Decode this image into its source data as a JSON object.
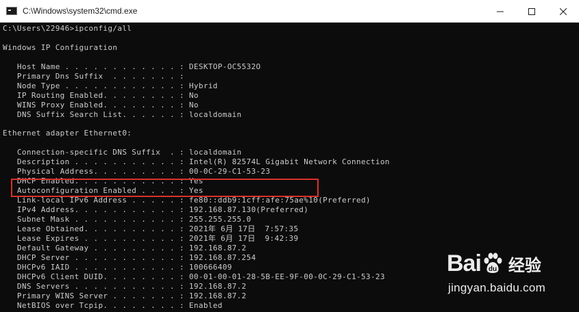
{
  "window": {
    "title": "C:\\Windows\\system32\\cmd.exe",
    "minimize_icon": "minimize-icon",
    "maximize_icon": "maximize-icon",
    "close_icon": "close-icon"
  },
  "console": {
    "lines": [
      "C:\\Users\\22946>ipconfig/all",
      "",
      "Windows IP Configuration",
      "",
      "   Host Name . . . . . . . . . . . . : DESKTOP-OC5532O",
      "   Primary Dns Suffix  . . . . . . . :",
      "   Node Type . . . . . . . . . . . . : Hybrid",
      "   IP Routing Enabled. . . . . . . . : No",
      "   WINS Proxy Enabled. . . . . . . . : No",
      "   DNS Suffix Search List. . . . . . : localdomain",
      "",
      "Ethernet adapter Ethernet0:",
      "",
      "   Connection-specific DNS Suffix  . : localdomain",
      "   Description . . . . . . . . . . . : Intel(R) 82574L Gigabit Network Connection",
      "   Physical Address. . . . . . . . . : 00-0C-29-C1-53-23",
      "   DHCP Enabled. . . . . . . . . . . : Yes",
      "   Autoconfiguration Enabled . . . . : Yes",
      "   Link-local IPv6 Address . . . . . : fe80::ddb9:1cff:afe:75ae%10(Preferred)",
      "   IPv4 Address. . . . . . . . . . . : 192.168.87.130(Preferred)",
      "   Subnet Mask . . . . . . . . . . . : 255.255.255.0",
      "   Lease Obtained. . . . . . . . . . : 2021年 6月 17日  7:57:35",
      "   Lease Expires . . . . . . . . . . : 2021年 6月 17日  9:42:39",
      "   Default Gateway . . . . . . . . . : 192.168.87.2",
      "   DHCP Server . . . . . . . . . . . : 192.168.87.254",
      "   DHCPv6 IAID . . . . . . . . . . . : 100666409",
      "   DHCPv6 Client DUID. . . . . . . . : 00-01-00-01-28-5B-EE-9F-00-0C-29-C1-53-23",
      "   DNS Servers . . . . . . . . . . . : 192.168.87.2",
      "   Primary WINS Server . . . . . . . : 192.168.87.2",
      "   NetBIOS over Tcpip. . . . . . . . : Enabled"
    ]
  },
  "watermark": {
    "brand": "Bai",
    "brand_suffix": "经验",
    "url": "jingyan.baidu.com"
  },
  "colors": {
    "console_bg": "#0c0c0c",
    "console_text": "#cccccc",
    "highlight": "#d9312b"
  }
}
